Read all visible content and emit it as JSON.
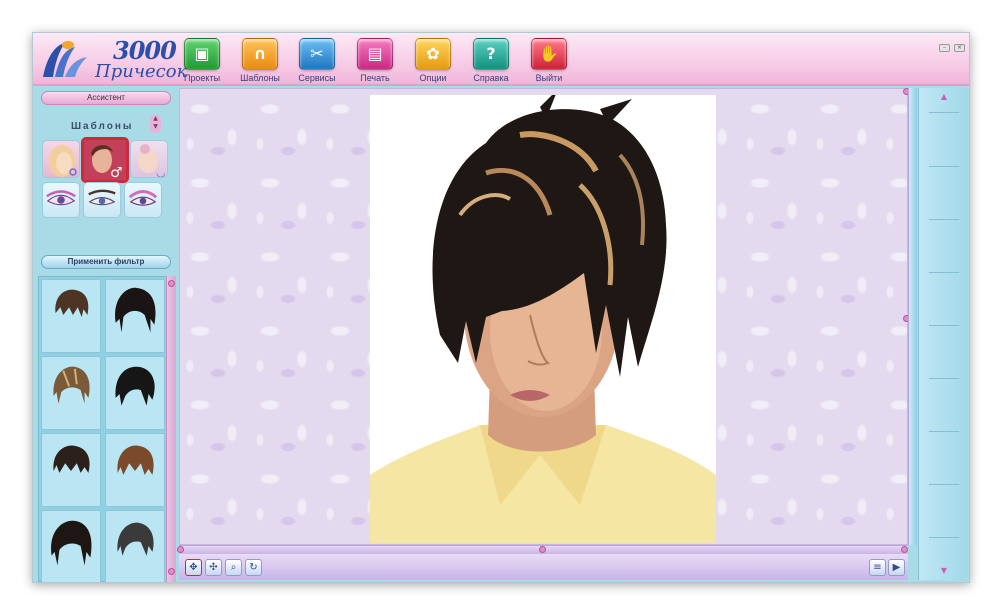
{
  "app": {
    "logo_number": "3000",
    "logo_subtitle": "Причесок"
  },
  "toolbar": [
    {
      "label": "Проекты",
      "icon": "projects-icon",
      "color": "#38b24a",
      "glyph": "▣"
    },
    {
      "label": "Шаблоны",
      "icon": "templates-icon",
      "color": "#f4a21c",
      "glyph": "∩"
    },
    {
      "label": "Сервисы",
      "icon": "services-icon",
      "color": "#2f8fd4",
      "glyph": "✂"
    },
    {
      "label": "Печать",
      "icon": "print-icon",
      "color": "#e0409a",
      "glyph": "▤"
    },
    {
      "label": "Опции",
      "icon": "options-icon",
      "color": "#f2b21c",
      "glyph": "✿"
    },
    {
      "label": "Справка",
      "icon": "help-icon",
      "color": "#27a99a",
      "glyph": "?"
    },
    {
      "label": "Выйти",
      "icon": "exit-icon",
      "color": "#e23a52",
      "glyph": "✋"
    }
  ],
  "left_panel": {
    "assistant_button": "Ассистент",
    "templates_title": "Шаблоны",
    "apply_filter_button": "Применить фильтр",
    "categories": [
      {
        "name": "female-category",
        "selected": false
      },
      {
        "name": "male-category",
        "selected": true
      },
      {
        "name": "child-category",
        "selected": false
      }
    ],
    "sub_categories": [
      "eyes-makeup",
      "eyebrows",
      "eyeshadow"
    ],
    "hairstyles_count": 8
  },
  "colors": {
    "accent_pink": "#e689c8",
    "panel_blue": "#a8dbe6",
    "selected_border": "#d0283a"
  }
}
